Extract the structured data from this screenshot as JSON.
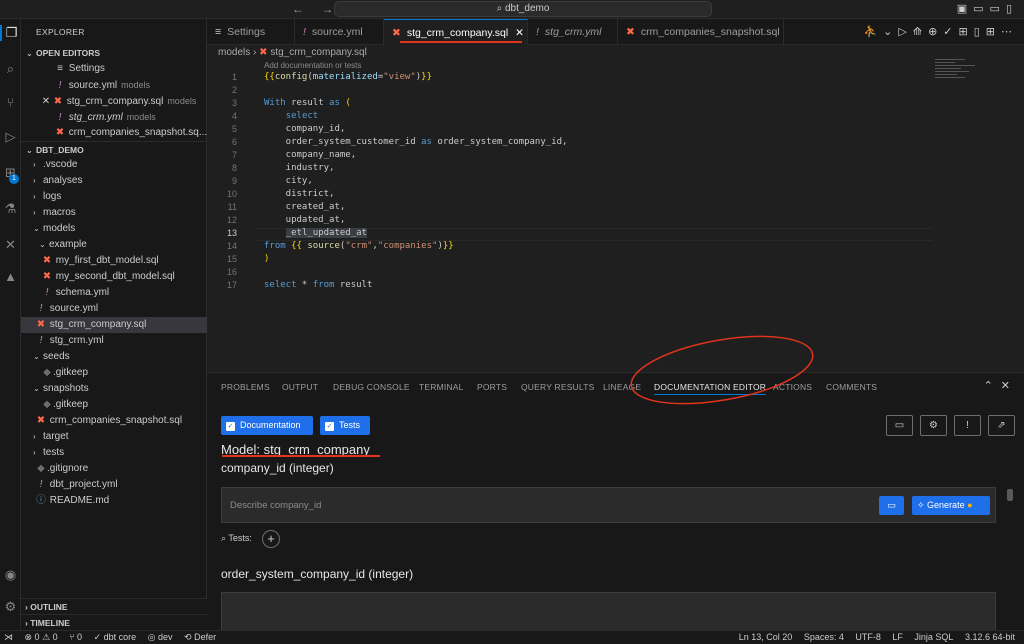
{
  "titlebar": {
    "back": "←",
    "forward": "→",
    "search": "⌕ dbt_demo"
  },
  "sidebar": {
    "title": "EXPLORER",
    "open_editors": "OPEN EDITORS",
    "editors": [
      {
        "name": "Settings",
        "sub": ""
      },
      {
        "name": "source.yml",
        "sub": "models"
      },
      {
        "name": "stg_crm_company.sql",
        "sub": "models"
      },
      {
        "name": "stg_crm.yml",
        "sub": "models"
      },
      {
        "name": "crm_companies_snapshot.sq...",
        "sub": ""
      }
    ],
    "project": "DBT_DEMO",
    "tree": [
      ".vscode",
      "analyses",
      "logs",
      "macros",
      "models",
      "example",
      "my_first_dbt_model.sql",
      "my_second_dbt_model.sql",
      "schema.yml",
      "source.yml",
      "stg_crm_company.sql",
      "stg_crm.yml",
      "seeds",
      ".gitkeep",
      "snapshots",
      ".gitkeep",
      "crm_companies_snapshot.sql",
      "target",
      "tests",
      ".gitignore",
      "dbt_project.yml",
      "README.md"
    ],
    "outline": "OUTLINE",
    "timeline": "TIMELINE",
    "badge": "1"
  },
  "tabs": [
    "Settings",
    "source.yml",
    "stg_crm_company.sql",
    "stg_crm.yml",
    "crm_companies_snapshot.sql"
  ],
  "editor": {
    "crumb_folder": "models",
    "crumb_file": "stg_crm_company.sql",
    "codelens": "Add documentation or tests",
    "line_numbers": [
      "1",
      "2",
      "3",
      "4",
      "5",
      "6",
      "7",
      "8",
      "9",
      "10",
      "11",
      "12",
      "13",
      "14",
      "15",
      "16",
      "17"
    ]
  },
  "panel": {
    "tabs": [
      "PROBLEMS",
      "OUTPUT",
      "DEBUG CONSOLE",
      "TERMINAL",
      "PORTS",
      "QUERY RESULTS",
      "LINEAGE",
      "DOCUMENTATION EDITOR",
      "ACTIONS",
      "COMMENTS"
    ],
    "documentation_btn": "Documentation",
    "tests_btn": "Tests",
    "model_title": "Model: stg_crm_company",
    "column1": "company_id (integer)",
    "placeholder": "Describe company_id",
    "generate": "Generate",
    "tests_label": "Tests:",
    "column2": "order_system_company_id (integer)"
  },
  "status": {
    "problems": "⊗ 0 ⚠ 0",
    "ports": "⑂ 0",
    "dbt_core": "✓ dbt core",
    "env": "◎ dev",
    "defer": "⟲ Defer",
    "position": "Ln 13, Col 20",
    "spaces": "Spaces: 4",
    "encoding": "UTF-8",
    "eol": "LF",
    "language": "Jinja SQL",
    "python": "3.12.6 64-bit"
  },
  "colors": {
    "accent": "#0078d4",
    "button": "#1f6feb",
    "dbt": "#ff694a",
    "annotation": "#e0341c"
  }
}
